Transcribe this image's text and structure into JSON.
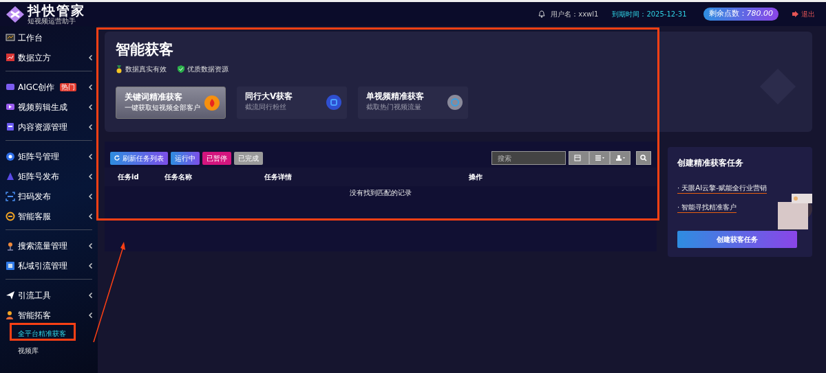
{
  "header": {
    "logo_title": "抖快管家",
    "logo_subtitle": "短视频运营助手",
    "username": "用户名：xxwl1",
    "expiry": "到期时间：2025-12-31",
    "points_label": "剩余点数：",
    "points_value": "780.00",
    "logout": "退出"
  },
  "sidebar": {
    "groups": [
      {
        "items": [
          {
            "label": "工作台",
            "has_submenu": false
          },
          {
            "label": "数据立方",
            "has_submenu": true
          }
        ]
      },
      {
        "items": [
          {
            "label": "AIGC创作",
            "badge": "热门",
            "has_submenu": true
          },
          {
            "label": "视频剪辑生成",
            "has_submenu": true
          },
          {
            "label": "内容资源管理",
            "has_submenu": true
          }
        ]
      },
      {
        "items": [
          {
            "label": "矩阵号管理",
            "has_submenu": true
          },
          {
            "label": "矩阵号发布",
            "has_submenu": true
          },
          {
            "label": "扫码发布",
            "has_submenu": true
          },
          {
            "label": "智能客服",
            "has_submenu": true
          }
        ]
      },
      {
        "items": [
          {
            "label": "搜索流量管理",
            "has_submenu": true
          },
          {
            "label": "私域引流管理",
            "has_submenu": true
          }
        ]
      },
      {
        "items": [
          {
            "label": "引流工具",
            "has_submenu": true
          },
          {
            "label": "智能拓客",
            "has_submenu": true,
            "children": [
              {
                "label": "全平台精准获客",
                "selected": true
              },
              {
                "label": "视频库",
                "selected": false
              }
            ]
          }
        ]
      }
    ]
  },
  "hero": {
    "title": "智能获客",
    "features": [
      "数据真实有效",
      "优质数据资源"
    ],
    "modes": [
      {
        "title": "关键词精准获客",
        "subtitle": "一键获取短视频全部客户",
        "selected": true
      },
      {
        "title": "同行大V获客",
        "subtitle": "截流同行粉丝",
        "selected": false
      },
      {
        "title": "单视频精准获客",
        "subtitle": "截取热门视频流量",
        "selected": false
      }
    ]
  },
  "toolbar": {
    "filters": [
      {
        "kind": "refresh",
        "label": "刷新任务列表"
      },
      {
        "kind": "running",
        "label": "运行中"
      },
      {
        "kind": "paused",
        "label": "已暂停"
      },
      {
        "kind": "done",
        "label": "已完成"
      }
    ],
    "search": {
      "placeholder": "搜索"
    }
  },
  "table": {
    "columns": [
      "任务id",
      "任务名称",
      "任务详情",
      "操作"
    ],
    "empty_message": "没有找到匹配的记录"
  },
  "create_panel": {
    "title": "创建精准获客任务",
    "links": [
      "· 天眼AI云擎-赋能全行业营销",
      "· 智能寻找精准客户"
    ],
    "button": "创建获客任务"
  }
}
